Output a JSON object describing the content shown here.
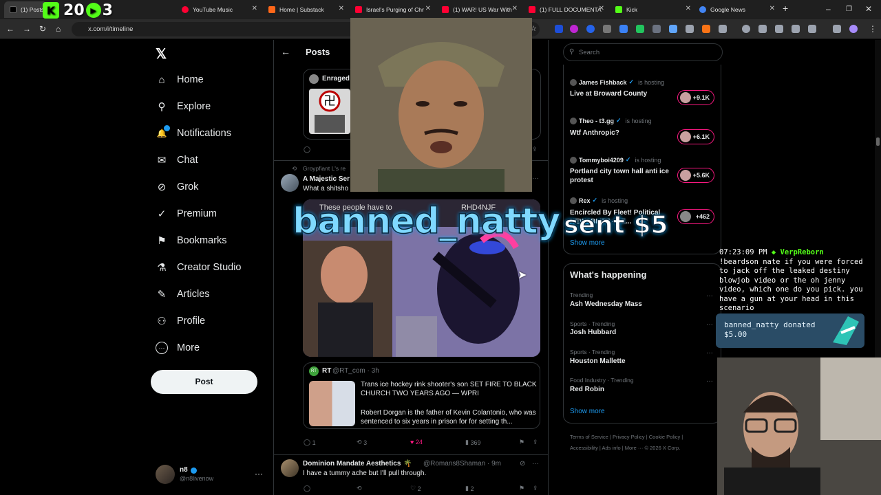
{
  "browser": {
    "tabs": [
      {
        "label": "(1) Posts /",
        "fav": "#000000",
        "active": true
      },
      {
        "label": "YouTube Music",
        "fav": "#ff0033"
      },
      {
        "label": "Home | Substack",
        "fav": "#ff6719"
      },
      {
        "label": "Israel's Purging of Chr",
        "fav": "#ff0033"
      },
      {
        "label": "(1) WAR! US War With",
        "fav": "#ff0033"
      },
      {
        "label": "(1) FULL DOCUMENTA",
        "fav": "#ff0033"
      },
      {
        "label": "Kick",
        "fav": "#53fc18"
      },
      {
        "label": "Google News",
        "fav": "#4285f4"
      }
    ],
    "new_tab": "+",
    "url": "x.com/i/timeline",
    "window_controls": [
      "–",
      "❐",
      "✕"
    ]
  },
  "stream_overlay": {
    "counter_a": "2",
    "counter_b": "0",
    "counter_c": "3",
    "donation_user": "banned_natty",
    "donation_sent": "sent $5",
    "chat_time": "07:23:09 PM",
    "chat_user": "VerpReborn",
    "chat_message": "!beardson nate if you were forced to jack off the leaked destiny blowjob video or the oh jenny video, which one do you pick. you have a gun at your head in this scenario",
    "donation_box_line1": "banned_natty donated",
    "donation_box_line2": "$5.00"
  },
  "sidebar": {
    "logo": "𝕏",
    "items": [
      {
        "label": "Home",
        "icon": "⌂"
      },
      {
        "label": "Explore",
        "icon": "⚲"
      },
      {
        "label": "Notifications",
        "icon": "🔔"
      },
      {
        "label": "Chat",
        "icon": "✉"
      },
      {
        "label": "Grok",
        "icon": "⊘"
      },
      {
        "label": "Premium",
        "icon": "✓"
      },
      {
        "label": "Bookmarks",
        "icon": "⚑"
      },
      {
        "label": "Creator Studio",
        "icon": "⚗"
      },
      {
        "label": "Articles",
        "icon": "✎"
      },
      {
        "label": "Profile",
        "icon": "⚇"
      },
      {
        "label": "More",
        "icon": "⋯"
      }
    ],
    "post_button": "Post",
    "user_name": "n8",
    "user_handle": "@n8livenow"
  },
  "feed": {
    "header_title": "Posts",
    "quote_top_label": "Enraged",
    "post1": {
      "repost_by": "Groypfiant L's re",
      "author": "A Majestic Ser",
      "text": "What a shitsho",
      "media_caption": "These people have to",
      "media_tag": "RHD4NJF",
      "quote_author": "RT",
      "quote_handle": "@RT_com · 3h",
      "quote_headline": "Trans ice hockey rink shooter's son SET FIRE TO BLACK CHURCH TWO YEARS AGO — WPRI",
      "quote_body": "Robert Dorgan is the father of Kevin Colantonio, who was sentenced to six years in prison for for setting th...",
      "replies": "1",
      "reposts": "3",
      "likes": "24",
      "views": "369"
    },
    "post2": {
      "author": "Dominion Mandate Aesthetics",
      "handle": "@Romans8Shaman · 9m",
      "text": "I have a tummy ache but I'll pull through.",
      "reposts": "",
      "likes": "2",
      "views": "2"
    }
  },
  "right": {
    "search_placeholder": "Search",
    "spaces": [
      {
        "host": "James Fishback",
        "status": "is hosting",
        "title": "Live at Broward County",
        "count": "+9.1K"
      },
      {
        "host": "Theo - t3.gg",
        "status": "is hosting",
        "title": "Wtf Anthropic?",
        "count": "+6.1K"
      },
      {
        "host": "Tommyboi4209",
        "status": "is hosting",
        "title": "Portland city town hall anti ice protest",
        "count": "+5.6K"
      },
      {
        "host": "Rex",
        "status": "is hosting",
        "title": "Encircled By Fleet! Political NEWSBLITZ - RE...",
        "count": "+462"
      }
    ],
    "show_more_1": "Show more",
    "happening_title": "What's happening",
    "trends": [
      {
        "cat": "Trending",
        "name": "Ash Wednesday Mass"
      },
      {
        "cat": "Sports · Trending",
        "name": "Josh Hubbard"
      },
      {
        "cat": "Sports · Trending",
        "name": "Houston Mallette"
      },
      {
        "cat": "Food Industry · Trending",
        "name": "Red Robin"
      }
    ],
    "show_more_2": "Show more",
    "footer_line1": "Terms of Service  |  Privacy Policy  |  Cookie Policy  |",
    "footer_line2": "Accessibility  |  Ads info  |  More ···  © 2026 X Corp."
  },
  "colors": {
    "bg": "#000000",
    "border": "#2f3336",
    "accent": "#1d9bf0",
    "like": "#f91880",
    "kick": "#53fc18"
  }
}
